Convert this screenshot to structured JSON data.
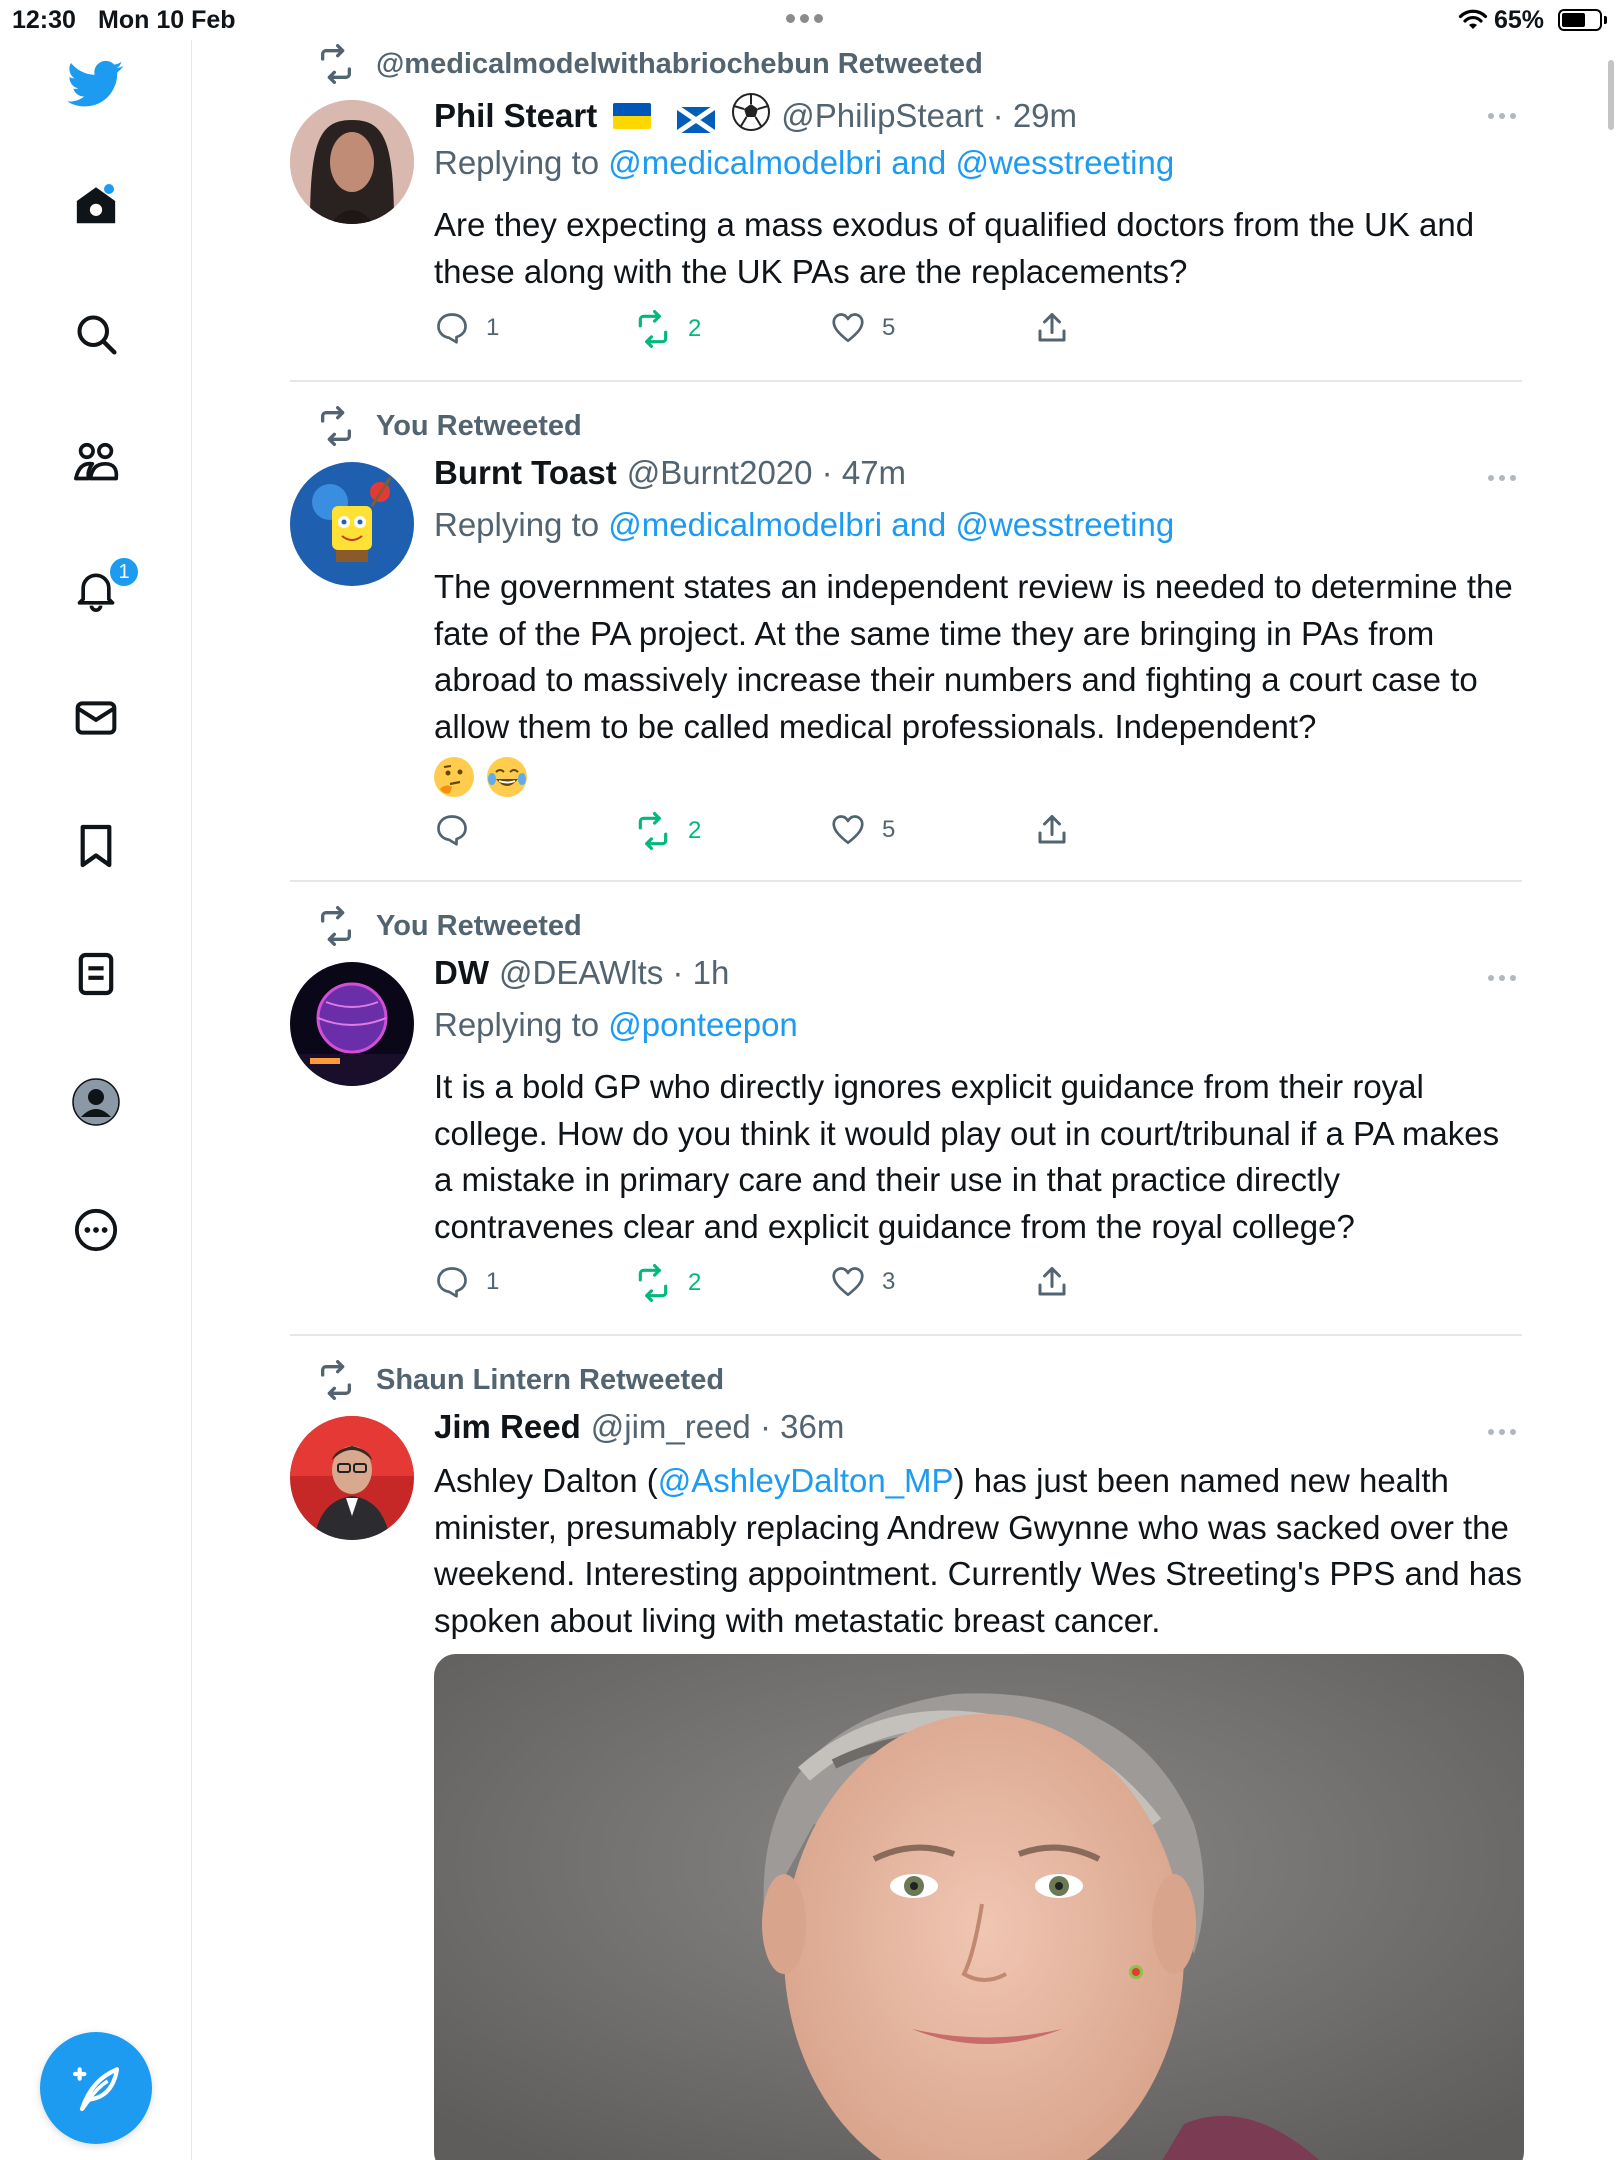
{
  "status_bar": {
    "time": "12:30",
    "date": "Mon 10 Feb",
    "battery": "65%",
    "battery_level": 0.65
  },
  "sidebar": {
    "items": [
      {
        "icon": "twitter-bird-icon"
      },
      {
        "icon": "home-icon"
      },
      {
        "icon": "search-icon"
      },
      {
        "icon": "communities-icon"
      },
      {
        "icon": "notifications-bell-icon",
        "badge": "1"
      },
      {
        "icon": "messages-icon"
      },
      {
        "icon": "bookmark-icon"
      },
      {
        "icon": "lists-icon"
      },
      {
        "icon": "profile-icon"
      },
      {
        "icon": "more-icon"
      }
    ],
    "compose_icon": "compose-feather-icon"
  },
  "colors": {
    "accent": "#1d9bf0",
    "retweet_green": "#00ba7c",
    "muted": "#536471"
  },
  "tweets": [
    {
      "retweeted_by": "@medicalmodelwithabriochebun Retweeted",
      "name": "Phil Steart",
      "handle": "@PhilipSteart",
      "time": "29m",
      "replying_prefix": "Replying to",
      "replying_to_1": "@medicalmodelbri",
      "replying_and": "and",
      "replying_to_2": "@wesstreeting",
      "text": "Are they expecting a mass exodus of qualified doctors from the UK and these along with the UK PAs are the replacements?",
      "replies": "1",
      "retweets": "2",
      "likes": "5"
    },
    {
      "retweeted_by": "You Retweeted",
      "name": "Burnt Toast",
      "handle": "@Burnt2020",
      "time": "47m",
      "replying_prefix": "Replying to",
      "replying_to_1": "@medicalmodelbri",
      "replying_and": "and",
      "replying_to_2": "@wesstreeting",
      "text": "The government states an independent review is needed to determine the fate of the PA project. At the same time they are bringing in PAs from abroad to massively increase their numbers and fighting a court case to allow them to be called medical professionals. Independent?",
      "emojis": [
        "thinking-face",
        "tears-of-joy"
      ],
      "replies": "",
      "retweets": "2",
      "likes": "5"
    },
    {
      "retweeted_by": "You Retweeted",
      "name": "DW",
      "handle": "@DEAWlts",
      "time": "1h",
      "replying_prefix": "Replying to",
      "replying_to_1": "@ponteepon",
      "text": "It is a bold GP who directly ignores explicit guidance from their royal college. How do you think it would play out in court/tribunal if a PA makes a mistake in primary care and their use in that practice directly contravenes clear and explicit guidance from the royal college?",
      "replies": "1",
      "retweets": "2",
      "likes": "3"
    },
    {
      "retweeted_by": "Shaun Lintern Retweeted",
      "name": "Jim Reed",
      "handle": "@jim_reed",
      "time": "36m",
      "text_before": "Ashley Dalton (",
      "text_mention": "@AshleyDalton_MP",
      "text_after": ") has just been named new health minister, presumably replacing Andrew Gwynne who was sacked over the weekend. Interesting appointment. Currently Wes Streeting's PPS and has spoken about living with metastatic breast cancer."
    }
  ]
}
